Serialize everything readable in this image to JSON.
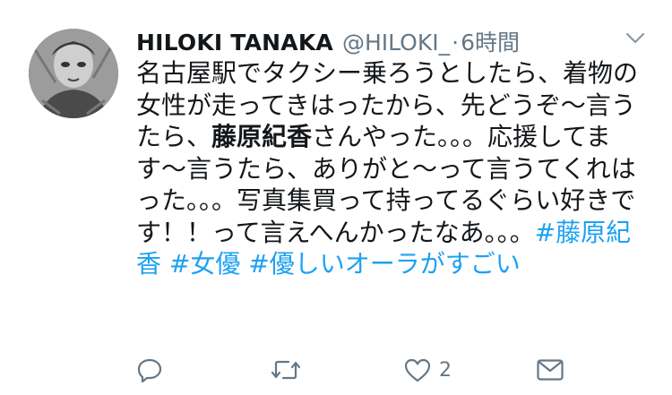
{
  "tweet": {
    "display_name": "HILOKI TANAKA",
    "handle": "@HILOKI_",
    "separator": "·",
    "time": "6時間",
    "text_segments": [
      {
        "text": "名古屋駅でタクシー乗ろうとしたら、着物の女性が走ってきはったから、先どうぞ〜言うたら、",
        "style": "normal"
      },
      {
        "text": "藤原紀香",
        "style": "bold"
      },
      {
        "text": "さんやった。。。応援してます〜言うたら、ありがと〜って言うてくれはった。。。写真集買って持ってるぐらい好きです！！って言えへんかったなあ。。。",
        "style": "normal"
      },
      {
        "text": "#藤原紀香",
        "style": "hashtag"
      },
      {
        "text": " ",
        "style": "normal"
      },
      {
        "text": "#女優",
        "style": "hashtag"
      },
      {
        "text": " ",
        "style": "normal"
      },
      {
        "text": "#優しいオーラがすごい",
        "style": "hashtag"
      }
    ],
    "like_count": "2"
  },
  "icons": {
    "menu": "chevron-down-icon",
    "reply": "reply-icon",
    "retweet": "retweet-icon",
    "like": "heart-icon",
    "dm": "mail-icon"
  },
  "colors": {
    "text": "#14171a",
    "secondary": "#657786",
    "link": "#1da1f2"
  }
}
